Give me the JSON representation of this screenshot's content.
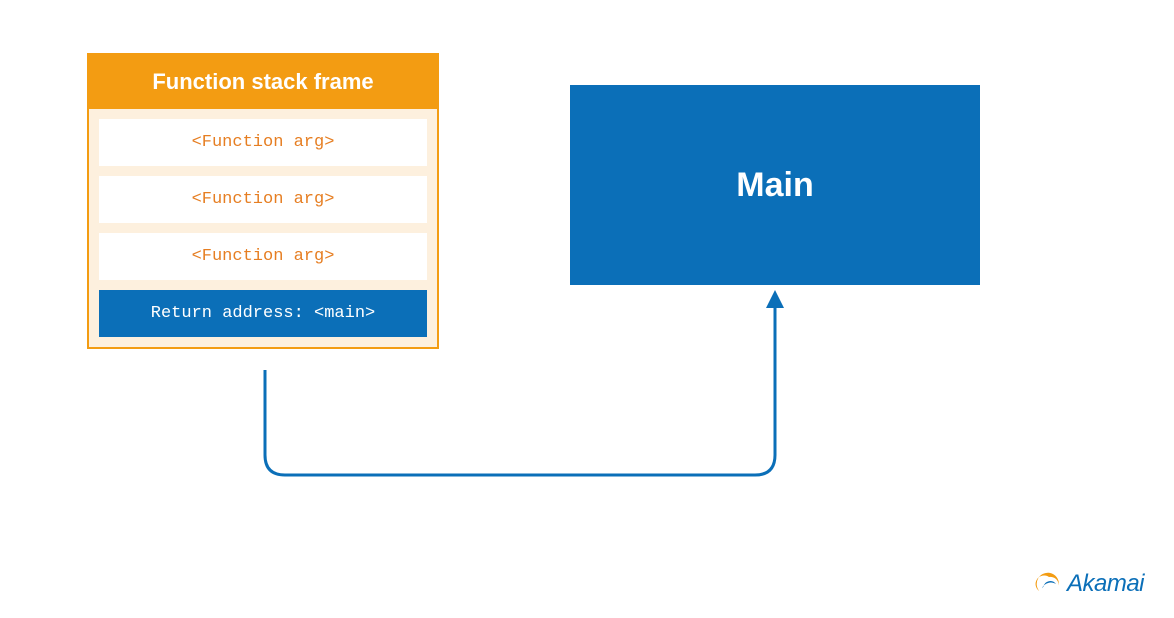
{
  "stack": {
    "title": "Function stack frame",
    "rows": [
      "<Function arg>",
      "<Function arg>",
      "<Function arg>"
    ],
    "return_row": "Return address: <main>"
  },
  "main_box": {
    "label": "Main"
  },
  "logo": {
    "text": "Akamai"
  },
  "colors": {
    "orange": "#f39c12",
    "orange_text": "#e67e22",
    "blue": "#0b6fb8",
    "peach_bg": "#fdf0de"
  }
}
